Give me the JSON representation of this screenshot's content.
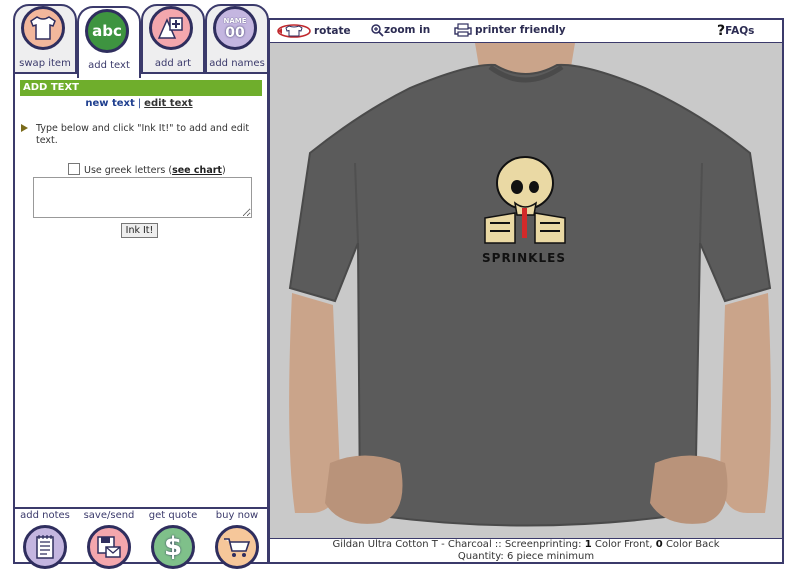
{
  "tabs": [
    {
      "label": "swap item",
      "icon": "tshirt-icon"
    },
    {
      "label": "add text",
      "icon": "abc-icon"
    },
    {
      "label": "add art",
      "icon": "add-art-icon"
    },
    {
      "label": "add names",
      "icon": "name-numbers-icon"
    }
  ],
  "tab_icon_text": {
    "abc": "abc",
    "name": "NAME",
    "num": "00"
  },
  "section": {
    "title": "ADD TEXT"
  },
  "subnav": {
    "new_text": "new text",
    "edit_text": "edit text"
  },
  "instructions": "Type below and click \"Ink It!\" to add and edit text.",
  "greek": {
    "label": "Use greek letters (",
    "link": "see chart",
    "close": ")"
  },
  "text_input": {
    "value": ""
  },
  "ink_button": "Ink It!",
  "bottom": [
    {
      "label": "add notes",
      "icon": "notepad-icon"
    },
    {
      "label": "save/send",
      "icon": "save-icon"
    },
    {
      "label": "get quote",
      "icon": "dollar-icon"
    },
    {
      "label": "buy now",
      "icon": "cart-icon"
    }
  ],
  "toolbar": {
    "rotate": "rotate",
    "zoom": "zoom in",
    "printer": "printer friendly",
    "faqs": "FAQs"
  },
  "design": {
    "logo_text": "SPRINKLES"
  },
  "footer": {
    "line1_prefix": "Gildan Ultra Cotton T - Charcoal :: Screenprinting: ",
    "front_count": "1",
    "front_label": " Color Front, ",
    "back_count": "0",
    "back_label": " Color Back",
    "line2": "Quantity: 6 piece minimum"
  },
  "colors": {
    "frame": "#3b3a6b",
    "accent_green": "#6fae2c",
    "shirt": "#5b5b5b",
    "stage_bg": "#c9c9c9"
  }
}
